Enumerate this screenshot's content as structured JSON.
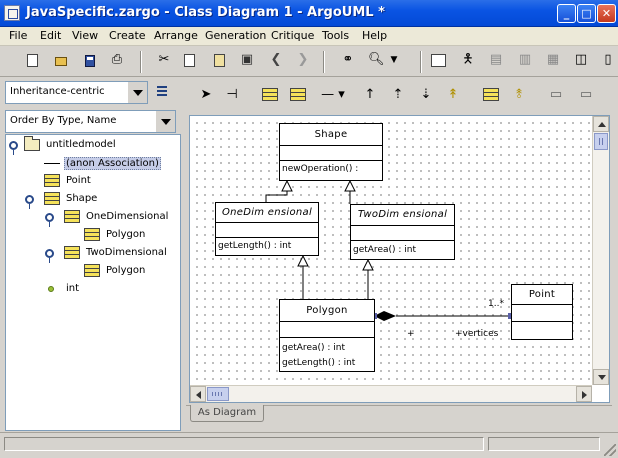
{
  "window": {
    "title": "JavaSpecific.zargo - Class Diagram 1 - ArgoUML *",
    "minimize": "_",
    "maximize": "□",
    "close": "✕"
  },
  "menu": [
    "File",
    "Edit",
    "View",
    "Create",
    "Arrange",
    "Generation",
    "Critique",
    "Tools",
    "Help"
  ],
  "toolbar": {
    "icons": [
      "new-file-icon",
      "open-folder-icon",
      "save-icon",
      "print-icon",
      "cut-icon",
      "copy-icon",
      "paste-icon",
      "delete-icon",
      "back-icon",
      "forward-icon",
      "find-icon",
      "zoom-icon",
      "dropdown-icon",
      "class-diagram-icon",
      "use-case-diagram-icon",
      "state-diagram-icon",
      "activity-diagram-icon",
      "collaboration-diagram-icon",
      "deployment-diagram-icon",
      "sequence-diagram-icon"
    ]
  },
  "explorer": {
    "perspective": "Inheritance-centric",
    "order": "Order By Type, Name",
    "tree": [
      {
        "label": "untitledmodel",
        "level": 0,
        "kind": "package",
        "expanded": true
      },
      {
        "label": "(anon Association)",
        "level": 1,
        "kind": "association",
        "selected": true
      },
      {
        "label": "Point",
        "level": 1,
        "kind": "class"
      },
      {
        "label": "Shape",
        "level": 1,
        "kind": "class",
        "expanded": true
      },
      {
        "label": "OneDimensional",
        "level": 2,
        "kind": "class",
        "expanded": true
      },
      {
        "label": "Polygon",
        "level": 3,
        "kind": "class"
      },
      {
        "label": "TwoDimensional",
        "level": 2,
        "kind": "class",
        "expanded": true
      },
      {
        "label": "Polygon",
        "level": 3,
        "kind": "class"
      },
      {
        "label": "int",
        "level": 1,
        "kind": "datatype"
      }
    ]
  },
  "diagram": {
    "classes": {
      "shape": {
        "name": "Shape",
        "ops": [
          "newOperation() :"
        ]
      },
      "one": {
        "name": "OneDim ensional",
        "ops": [
          "getLength() : int"
        ]
      },
      "two": {
        "name": "TwoDim ensional",
        "ops": [
          "getArea() : int"
        ]
      },
      "polygon": {
        "name": "Polygon",
        "ops": [
          "getArea() : int",
          "getLength() : int"
        ]
      },
      "point": {
        "name": "Point",
        "ops": []
      }
    },
    "association": {
      "multiplicity": "1..*",
      "end_plus": "+",
      "role": "+vertices"
    }
  },
  "tabs": {
    "as_diagram": "As Diagram"
  }
}
